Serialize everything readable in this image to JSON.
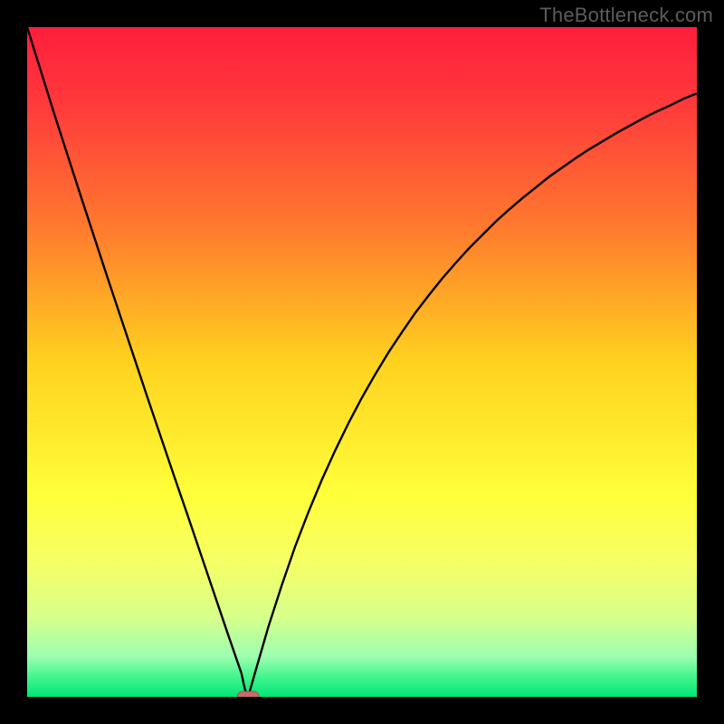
{
  "watermark": {
    "text": "TheBottleneck.com"
  },
  "colors": {
    "frame": "#000000",
    "watermark": "#5c5c5c",
    "curve_stroke": "#000000",
    "marker_fill": "#c96a6a",
    "marker_stroke": "#b24e4e",
    "gradient_stops": [
      {
        "offset": 0.0,
        "color": "#ff1e3c"
      },
      {
        "offset": 0.12,
        "color": "#ff3b3b"
      },
      {
        "offset": 0.3,
        "color": "#ff7a2e"
      },
      {
        "offset": 0.5,
        "color": "#ffd21f"
      },
      {
        "offset": 0.7,
        "color": "#ffff3a"
      },
      {
        "offset": 0.8,
        "color": "#f6ff66"
      },
      {
        "offset": 0.88,
        "color": "#d8ff8a"
      },
      {
        "offset": 0.94,
        "color": "#9cffb0"
      },
      {
        "offset": 0.97,
        "color": "#43f58e"
      },
      {
        "offset": 1.0,
        "color": "#00e676"
      }
    ]
  },
  "chart_data": {
    "type": "line",
    "title": "",
    "xlabel": "",
    "ylabel": "",
    "xlim": [
      0,
      1
    ],
    "ylim": [
      0,
      1
    ],
    "x": [
      0.0,
      0.02,
      0.04,
      0.06,
      0.08,
      0.1,
      0.12,
      0.14,
      0.16,
      0.18,
      0.2,
      0.22,
      0.24,
      0.26,
      0.28,
      0.3,
      0.31,
      0.32,
      0.325,
      0.33,
      0.34,
      0.36,
      0.38,
      0.4,
      0.42,
      0.44,
      0.46,
      0.48,
      0.5,
      0.52,
      0.54,
      0.56,
      0.58,
      0.6,
      0.62,
      0.64,
      0.66,
      0.68,
      0.7,
      0.72,
      0.74,
      0.76,
      0.78,
      0.8,
      0.82,
      0.84,
      0.86,
      0.88,
      0.9,
      0.92,
      0.94,
      0.96,
      0.98,
      1.0
    ],
    "values": [
      1.0,
      0.936,
      0.872,
      0.81,
      0.748,
      0.687,
      0.626,
      0.566,
      0.506,
      0.446,
      0.387,
      0.328,
      0.27,
      0.211,
      0.152,
      0.093,
      0.064,
      0.035,
      0.012,
      0.0,
      0.035,
      0.104,
      0.166,
      0.224,
      0.276,
      0.324,
      0.368,
      0.409,
      0.447,
      0.482,
      0.515,
      0.545,
      0.574,
      0.6,
      0.625,
      0.648,
      0.67,
      0.69,
      0.71,
      0.728,
      0.745,
      0.761,
      0.777,
      0.791,
      0.805,
      0.818,
      0.83,
      0.842,
      0.853,
      0.864,
      0.874,
      0.883,
      0.893,
      0.901
    ],
    "optimum": {
      "x": 0.33,
      "y": 0.0
    }
  }
}
